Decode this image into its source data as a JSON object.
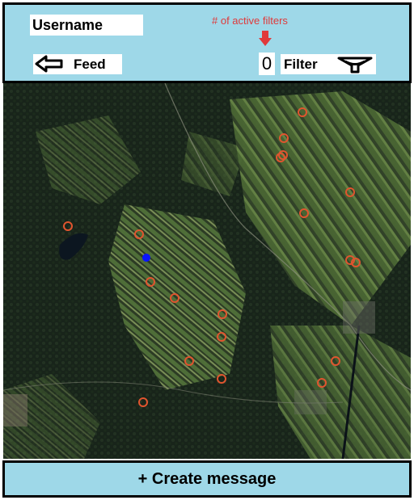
{
  "header": {
    "username": "Username",
    "active_filters_note": "# of active filters",
    "active_filters_count": "0",
    "feed_label": "Feed",
    "filter_label": "Filter"
  },
  "map": {
    "marker_color": "#e0552f",
    "user_location_color": "#0a14ff"
  },
  "footer": {
    "create_label": "+ Create message"
  }
}
